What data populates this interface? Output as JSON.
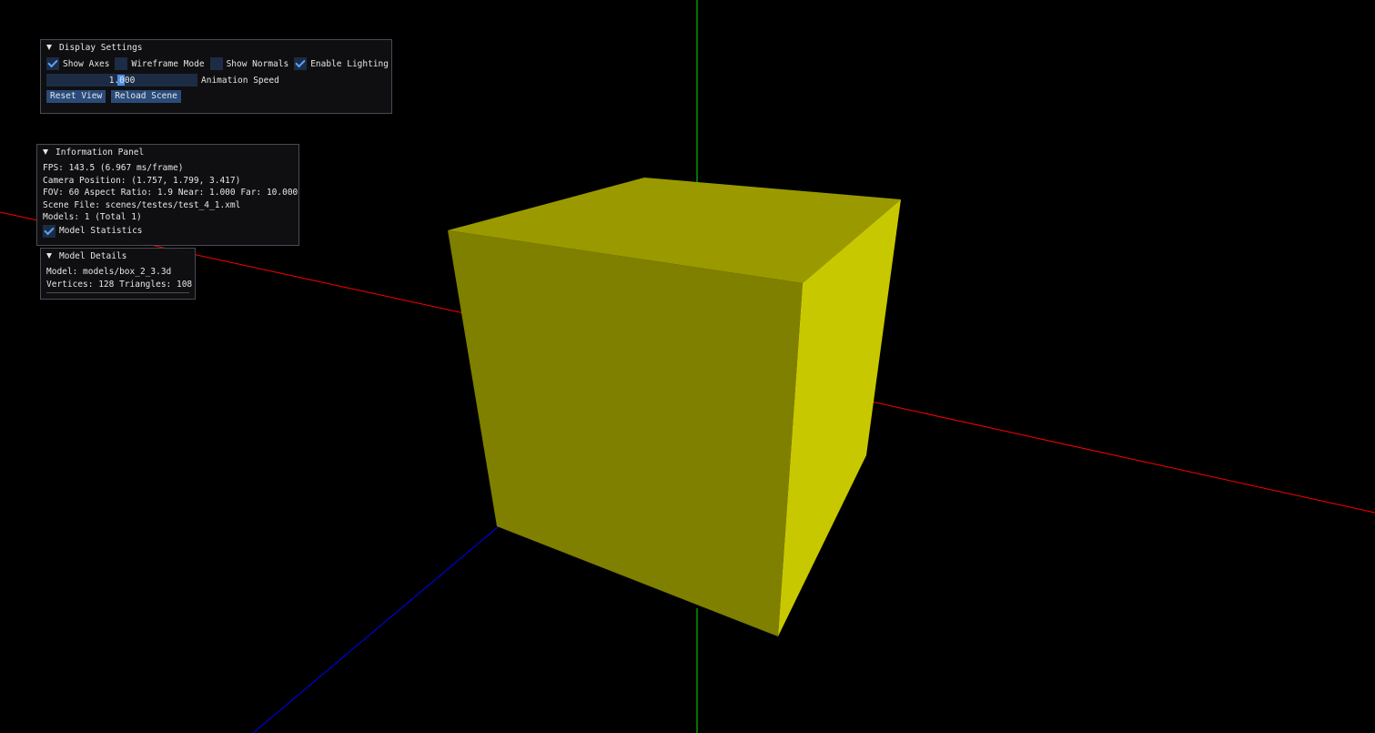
{
  "display_settings": {
    "title": "Display Settings",
    "checkboxes": {
      "show_axes": {
        "label": "Show Axes",
        "checked": true
      },
      "wireframe_mode": {
        "label": "Wireframe Mode",
        "checked": false
      },
      "show_normals": {
        "label": "Show Normals",
        "checked": false
      },
      "enable_lighting": {
        "label": "Enable Lighting",
        "checked": true
      }
    },
    "animation_speed": {
      "value": "1.000",
      "label": "Animation Speed"
    },
    "reset_view_label": "Reset View",
    "reload_scene_label": "Reload Scene"
  },
  "information_panel": {
    "title": "Information Panel",
    "fps": "FPS: 143.5 (6.967 ms/frame)",
    "camera_position": "Camera Position: (1.757, 1.799, 3.417)",
    "projection": "FOV: 60 Aspect Ratio: 1.9 Near: 1.000 Far: 10.000",
    "scene_file": "Scene File: scenes/testes/test_4_1.xml",
    "models": "Models: 1 (Total 1)",
    "model_statistics": {
      "label": "Model Statistics",
      "checked": true
    }
  },
  "model_details": {
    "title": "Model Details",
    "model": "Model: models/box_2_3.3d",
    "counts": "Vertices: 128 Triangles: 108"
  },
  "colors": {
    "background": "#000000",
    "x_axis": "#ff0000",
    "y_axis": "#00c000",
    "z_axis": "#0000ff",
    "cube_top": "#9a9a00",
    "cube_front": "#7f7f00",
    "cube_side": "#c8c800",
    "accent": "#4a8ee6",
    "widget_bg": "#1c2c44",
    "button_bg": "#2a4b7a"
  }
}
